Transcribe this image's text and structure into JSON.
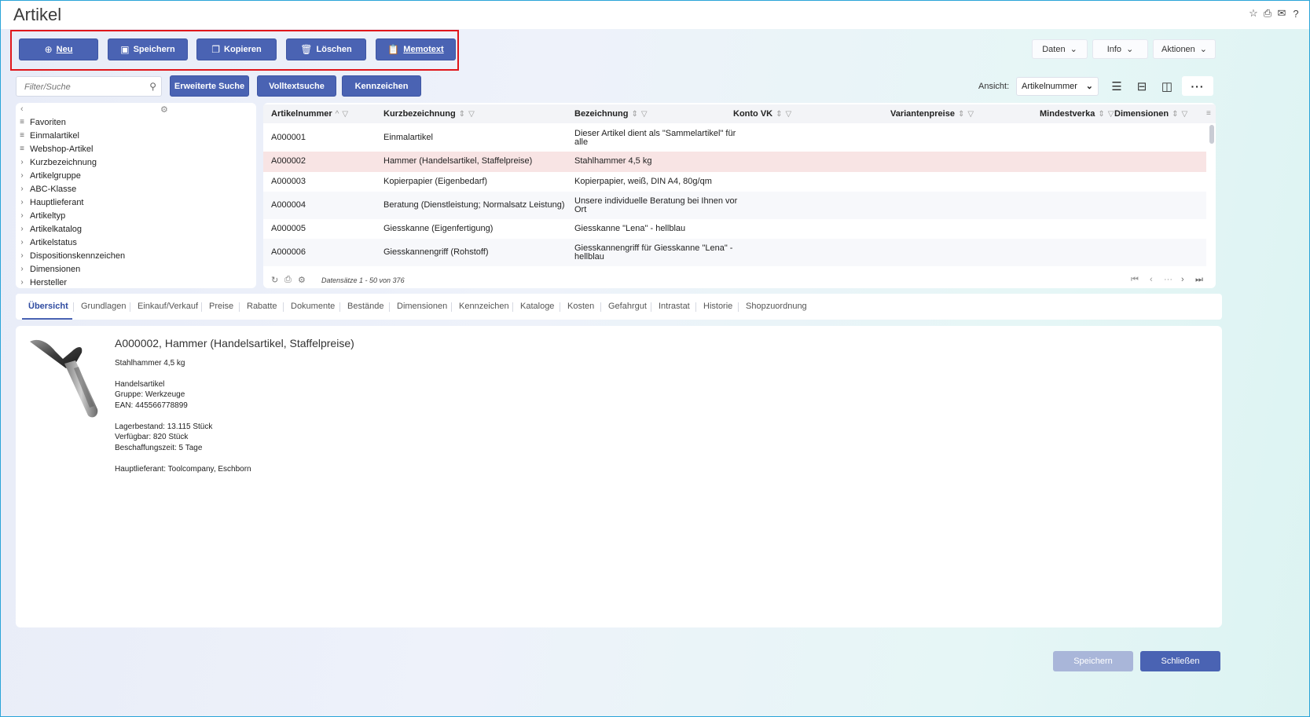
{
  "window": {
    "title": "Artikel"
  },
  "toolbar": {
    "new_label": "Neu",
    "save_label": "Speichern",
    "copy_label": "Kopieren",
    "delete_label": "Löschen",
    "memo_label": "Memotext",
    "data_menu": "Daten",
    "info_menu": "Info",
    "actions_menu": "Aktionen"
  },
  "search": {
    "placeholder": "Filter/Suche",
    "advanced_label": "Erweiterte Suche",
    "fulltext_label": "Volltextsuche",
    "flags_label": "Kennzeichen"
  },
  "view": {
    "label": "Ansicht:",
    "selected": "Artikelnummer"
  },
  "tree": {
    "items": [
      {
        "label": "Favoriten",
        "icon": "filter-lines-icon"
      },
      {
        "label": "Einmalartikel",
        "icon": "filter-lines-icon"
      },
      {
        "label": "Webshop-Artikel",
        "icon": "filter-lines-icon"
      },
      {
        "label": "Kurzbezeichnung",
        "icon": "chevron-right-icon"
      },
      {
        "label": "Artikelgruppe",
        "icon": "chevron-right-icon"
      },
      {
        "label": "ABC-Klasse",
        "icon": "chevron-right-icon"
      },
      {
        "label": "Hauptlieferant",
        "icon": "chevron-right-icon"
      },
      {
        "label": "Artikeltyp",
        "icon": "chevron-right-icon"
      },
      {
        "label": "Artikelkatalog",
        "icon": "chevron-right-icon"
      },
      {
        "label": "Artikelstatus",
        "icon": "chevron-right-icon"
      },
      {
        "label": "Dispositionskennzeichen",
        "icon": "chevron-right-icon"
      },
      {
        "label": "Dimensionen",
        "icon": "chevron-right-icon"
      },
      {
        "label": "Hersteller",
        "icon": "chevron-right-icon"
      }
    ]
  },
  "grid": {
    "columns": [
      "Artikelnummer",
      "Kurzbezeichnung",
      "Bezeichnung",
      "Konto VK",
      "Variantenpreise",
      "Mindestverka",
      "Dimensionen"
    ],
    "rows": [
      {
        "nr": "A000001",
        "kurz": "Einmalartikel",
        "bez1": "Dieser Artikel dient als \"Sammelartikel\" für",
        "bez2": "alle"
      },
      {
        "nr": "A000002",
        "kurz": "Hammer (Handelsartikel, Staffelpreise)",
        "bez1": "Stahlhammer 4,5 kg",
        "bez2": ""
      },
      {
        "nr": "A000003",
        "kurz": "Kopierpapier (Eigenbedarf)",
        "bez1": "Kopierpapier, weiß, DIN A4, 80g/qm",
        "bez2": ""
      },
      {
        "nr": "A000004",
        "kurz": "Beratung (Dienstleistung; Normalsatz Leistung)",
        "bez1": "Unsere individuelle Beratung bei Ihnen vor",
        "bez2": "Ort"
      },
      {
        "nr": "A000005",
        "kurz": "Giesskanne (Eigenfertigung)",
        "bez1": "Giesskanne \"Lena\" - hellblau",
        "bez2": ""
      },
      {
        "nr": "A000006",
        "kurz": "Giesskannengriff (Rohstoff)",
        "bez1": "Giesskannengriff für Giesskanne \"Lena\" -",
        "bez2": "hellblau"
      }
    ],
    "record_count": "Datensätze 1 - 50 von 376",
    "selected_row_color": "#f8e4e4"
  },
  "tabs": [
    "Übersicht",
    "Grundlagen",
    "Einkauf/Verkauf",
    "Preise",
    "Rabatte",
    "Dokumente",
    "Bestände",
    "Dimensionen",
    "Kennzeichen",
    "Kataloge",
    "Kosten",
    "Gefahrgut",
    "Intrastat",
    "Historie",
    "Shopzuordnung"
  ],
  "detail": {
    "heading": "A000002, Hammer (Handelsartikel, Staffelpreise)",
    "description": "Stahlhammer 4,5 kg",
    "type": "Handelsartikel",
    "group": "Gruppe: Werkzeuge",
    "ean": "EAN: 445566778899",
    "stock": "Lagerbestand: 13.115 Stück",
    "available": "Verfügbar: 820 Stück",
    "lead_time": "Beschaffungszeit: 5 Tage",
    "supplier": "Hauptlieferant: Toolcompany, Eschborn"
  },
  "footer": {
    "save_label": "Speichern",
    "close_label": "Schließen"
  },
  "colors": {
    "accent": "#4a63b3",
    "highlight_border": "#e0161b"
  }
}
